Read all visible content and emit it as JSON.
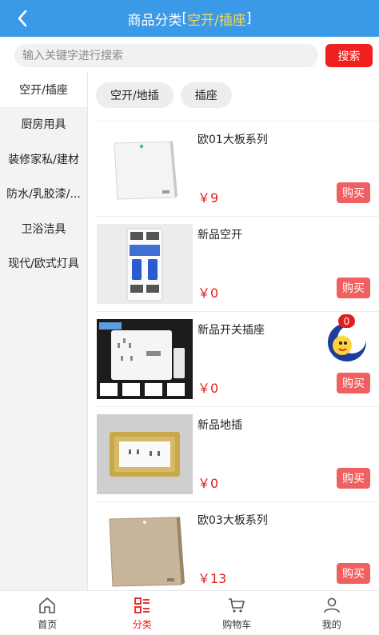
{
  "header": {
    "back_icon": "chevron-left-icon",
    "title_main": "商品分类",
    "title_bracket_open": "[",
    "title_sub": "空开/插座",
    "title_bracket_close": "]"
  },
  "search": {
    "placeholder": "输入关键字进行搜索",
    "button_label": "搜索"
  },
  "sidebar": {
    "items": [
      {
        "label": "空开/插座",
        "active": true
      },
      {
        "label": "厨房用具",
        "active": false
      },
      {
        "label": "装修家私/建材",
        "active": false
      },
      {
        "label": "防水/乳胶漆/...",
        "active": false
      },
      {
        "label": "卫浴洁具",
        "active": false
      },
      {
        "label": "现代/欧式灯具",
        "active": false
      }
    ]
  },
  "subcategories": [
    {
      "label": "空开/地插"
    },
    {
      "label": "插座"
    }
  ],
  "products": [
    {
      "name": "欧01大板系列",
      "price": "￥9",
      "buy_label": "购买",
      "image": "white-switch-panel"
    },
    {
      "name": "新品空开",
      "price": "￥0",
      "buy_label": "购买",
      "image": "circuit-breaker"
    },
    {
      "name": "新品开关插座",
      "price": "￥0",
      "buy_label": "购买",
      "image": "socket-panel"
    },
    {
      "name": "新品地插",
      "price": "￥0",
      "buy_label": "购买",
      "image": "floor-socket"
    },
    {
      "name": "欧03大板系列",
      "price": "￥13",
      "buy_label": "购买",
      "image": "wood-switch-panel"
    }
  ],
  "floating": {
    "badge_count": "0",
    "icon": "moon-mascot-icon"
  },
  "bottom_nav": [
    {
      "label": "首页",
      "icon": "home-icon",
      "active": false
    },
    {
      "label": "分类",
      "icon": "category-icon",
      "active": true
    },
    {
      "label": "购物车",
      "icon": "cart-icon",
      "active": false
    },
    {
      "label": "我的",
      "icon": "user-icon",
      "active": false
    }
  ],
  "colors": {
    "header_bg": "#3a9ae8",
    "accent_red": "#e61f1f",
    "buy_button": "#f06060",
    "title_highlight": "#ffd84d"
  }
}
